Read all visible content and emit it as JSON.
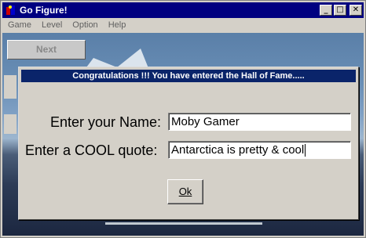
{
  "window": {
    "title": "Go Figure!",
    "min_label": "_",
    "max_label": "□",
    "close_label": "✕"
  },
  "menu": [
    {
      "label": "Game"
    },
    {
      "label": "Level"
    },
    {
      "label": "Option"
    },
    {
      "label": "Help"
    }
  ],
  "toolbar": {
    "next_label": "Next"
  },
  "dialog": {
    "title": "Congratulations !!!   You have entered the Hall of Fame.....",
    "name_label": "Enter your Name:",
    "name_value": "Moby Gamer",
    "quote_label": "Enter a COOL quote:",
    "quote_value": "Antarctica is pretty & cool",
    "ok_label": "Ok"
  },
  "colors": {
    "titlebar": "#000080",
    "dialog_titlebar": "#0a246a",
    "face": "#d4d0c8"
  }
}
